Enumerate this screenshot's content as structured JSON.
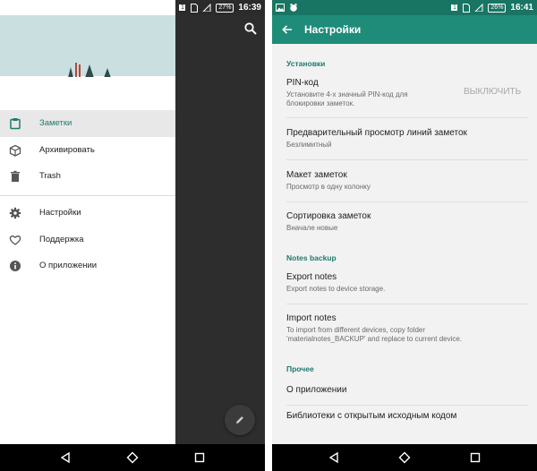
{
  "left": {
    "status": {
      "sim_badge": "1",
      "battery": "27%",
      "time": "16:39"
    },
    "drawer": {
      "items": [
        {
          "label": "Заметки",
          "icon": "notes-icon",
          "active": true
        },
        {
          "label": "Архивировать",
          "icon": "archive-box-icon",
          "active": false
        },
        {
          "label": "Trash",
          "icon": "trash-icon",
          "active": false
        },
        {
          "label": "Настройки",
          "icon": "gear-icon",
          "active": false
        },
        {
          "label": "Поддержка",
          "icon": "heart-icon",
          "active": false
        },
        {
          "label": "О приложении",
          "icon": "info-icon",
          "active": false
        }
      ]
    }
  },
  "right": {
    "status": {
      "sim_badge": "1",
      "battery": "26%",
      "time": "16:41"
    },
    "appbar": {
      "title": "Настройки"
    },
    "sections": {
      "install": "Установки",
      "backup": "Notes backup",
      "other": "Прочее"
    },
    "prefs": {
      "pin": {
        "title": "PIN-код",
        "summary_line1": "Установите 4-х значный PIN-код для",
        "summary_line2": "блокировки заметок.",
        "action": "ВЫКЛЮЧИТЬ"
      },
      "preview": {
        "title": "Предварительный просмотр линий заметок",
        "summary": "Безлимитный"
      },
      "layout": {
        "title": "Макет заметок",
        "summary": "Просмотр в одну колонку"
      },
      "sort": {
        "title": "Сортировка заметок",
        "summary": "Вначале новые"
      },
      "export": {
        "title": "Export notes",
        "summary": "Export notes to device storage."
      },
      "import": {
        "title": "Import notes",
        "summary_line1": "To import from different devices, copy folder",
        "summary_line2": "'materialnotes_BACKUP' and replace to current device."
      },
      "about": {
        "title": "О приложении"
      },
      "libraries": {
        "title": "Библиотеки с открытым исходным кодом"
      }
    }
  },
  "colors": {
    "accent": "#1e8c79",
    "accent_text": "#1c7a6e",
    "header_sky": "#c9dfe0"
  }
}
